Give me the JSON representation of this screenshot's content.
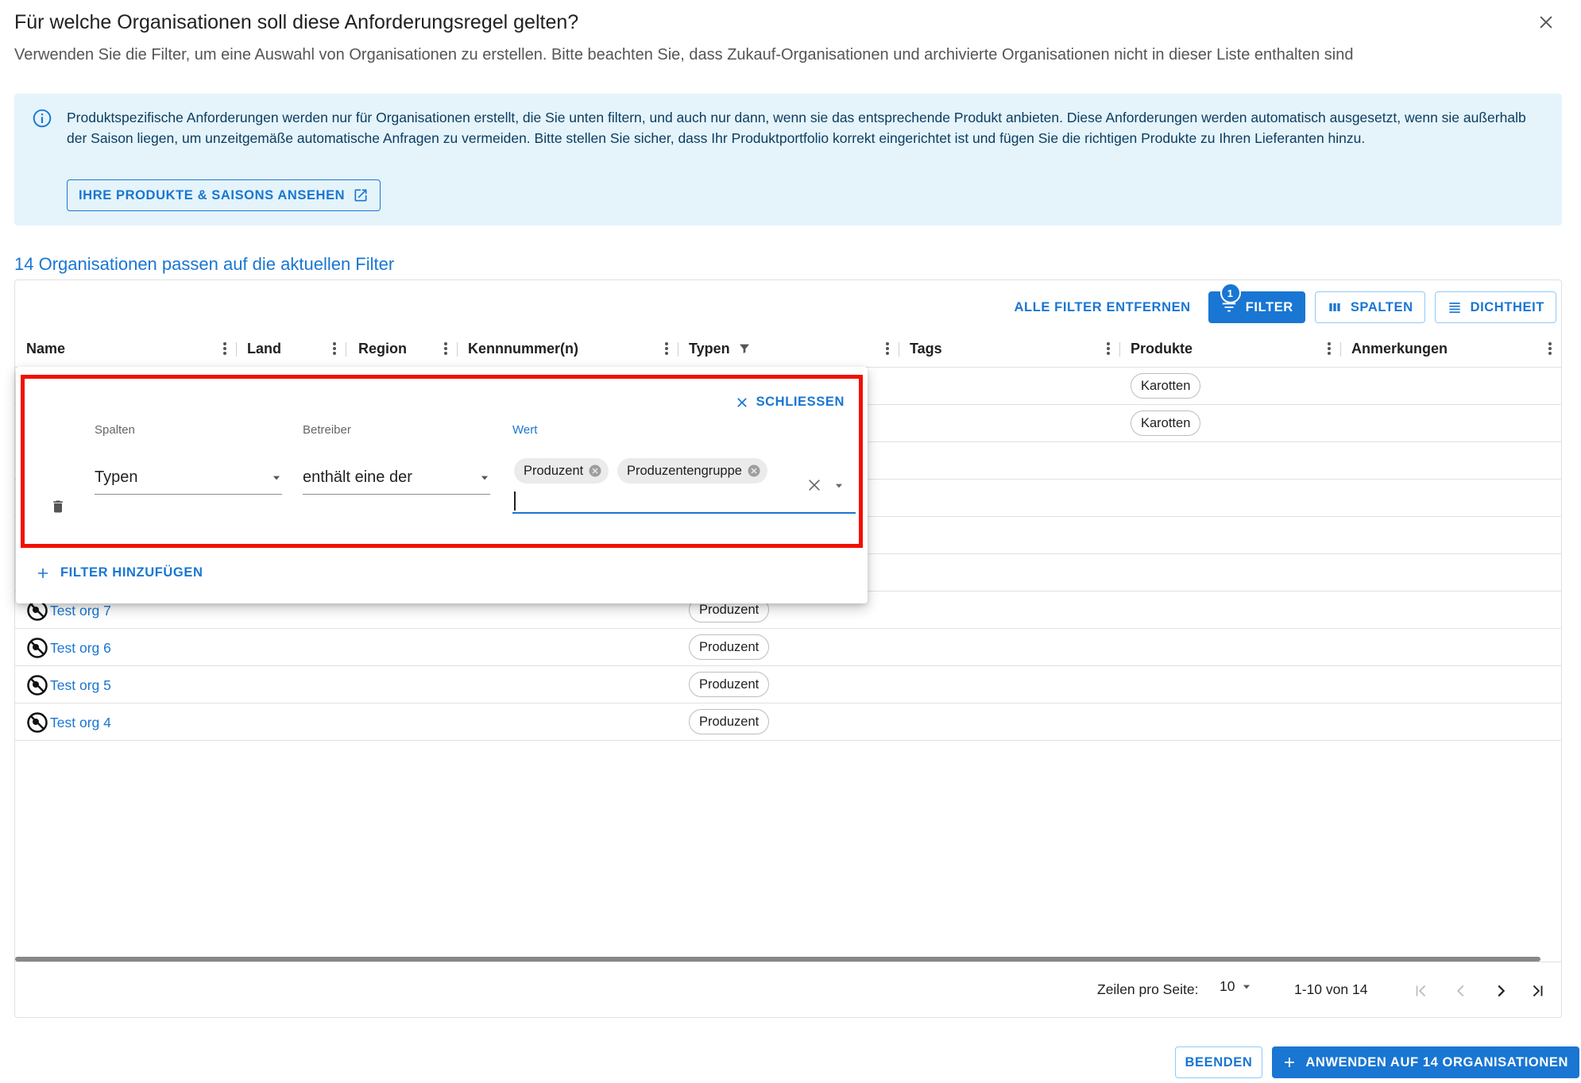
{
  "dialog": {
    "title": "Für welche Organisationen soll diese Anforderungsregel gelten?",
    "subtitle": "Verwenden Sie die Filter, um eine Auswahl von Organisationen zu erstellen. Bitte beachten Sie, dass Zukauf-Organisationen und archivierte Organisationen nicht in dieser Liste enthalten sind"
  },
  "info": {
    "text": "Produktspezifische Anforderungen werden nur für Organisationen erstellt, die Sie unten filtern, und auch nur dann, wenn sie das entsprechende Produkt anbieten. Diese Anforderungen werden automatisch ausgesetzt, wenn sie außerhalb der Saison liegen, um unzeitgemäße automatische Anfragen zu vermeiden. Bitte stellen Sie sicher, dass Ihr Produktportfolio korrekt eingerichtet ist und fügen Sie die richtigen Produkte zu Ihren Lieferanten hinzu.",
    "button_label": "IHRE PRODUKTE & SAISONS ANSEHEN"
  },
  "count_heading": "14 Organisationen passen auf die aktuellen Filter",
  "toolbar": {
    "clear_filters": "ALLE FILTER ENTFERNEN",
    "filter": "FILTER",
    "filter_badge": "1",
    "columns": "SPALTEN",
    "density": "DICHTHEIT"
  },
  "columns": {
    "name": "Name",
    "land": "Land",
    "region": "Region",
    "kennnummer": "Kennnummer(n)",
    "typen": "Typen",
    "tags": "Tags",
    "produkte": "Produkte",
    "anmerkungen": "Anmerkungen"
  },
  "rows_top": [
    {
      "produkt": "Karotten"
    },
    {
      "produkt": "Karotten"
    }
  ],
  "rows": [
    {
      "name": "Test org 7",
      "typ": "Produzent"
    },
    {
      "name": "Test org 6",
      "typ": "Produzent"
    },
    {
      "name": "Test org 5",
      "typ": "Produzent"
    },
    {
      "name": "Test org 4",
      "typ": "Produzent"
    }
  ],
  "filter_panel": {
    "close_label": "SCHLIESSEN",
    "label_columns": "Spalten",
    "label_operator": "Betreiber",
    "label_value": "Wert",
    "column_value": "Typen",
    "operator_value": "enthält eine der",
    "value_chips": [
      "Produzent",
      "Produzentengruppe"
    ],
    "add_filter": "FILTER HINZUFÜGEN"
  },
  "pagination": {
    "rows_per_page_label": "Zeilen pro Seite:",
    "rows_per_page": "10",
    "range": "1-10 von 14"
  },
  "actions": {
    "finish": "BEENDEN",
    "apply": "ANWENDEN AUF 14 ORGANISATIONEN"
  },
  "colors": {
    "accent": "#1976d2",
    "info_bg": "#e4f4fa",
    "highlight": "#f20f00"
  }
}
